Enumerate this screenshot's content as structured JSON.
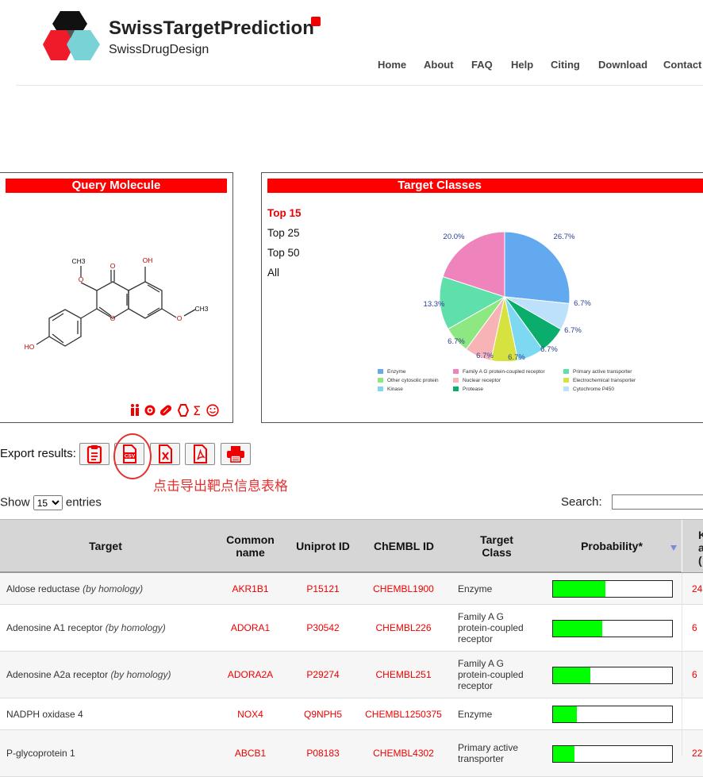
{
  "header": {
    "title": "SwissTargetPrediction",
    "subtitle": "SwissDrugDesign",
    "nav": [
      "Home",
      "About",
      "FAQ",
      "Help",
      "Citing",
      "Download",
      "Contact"
    ]
  },
  "query_panel": {
    "title": "Query Molecule",
    "atom_labels": [
      "CH3",
      "O",
      "O",
      "OH",
      "O",
      "HO",
      "O",
      "CH3"
    ],
    "tool_icons": [
      "family-icon",
      "target-icon",
      "pill-icon",
      "hexagon-icon",
      "sigma-icon",
      "smiley-icon"
    ]
  },
  "target_classes": {
    "title": "Target Classes",
    "options": [
      "Top 15",
      "Top 25",
      "Top 50",
      "All"
    ],
    "selected": "Top 15",
    "labels": [
      "26.7%",
      "6.7%",
      "6.7%",
      "6.7%",
      "6.7%",
      "6.7%",
      "6.7%",
      "13.3%",
      "20.0%"
    ],
    "legend": [
      "Enzyme",
      "Family A G protein-coupled receptor",
      "Primary active transporter",
      "Other cytosolic protein",
      "Nuclear receptor",
      "Electrochemical transporter",
      "Kinase",
      "Protease",
      "Cytochrome P450"
    ]
  },
  "chart_data": {
    "type": "pie",
    "title": "",
    "slices": [
      {
        "label": "Enzyme",
        "value": 26.7,
        "color": "#63a9f0"
      },
      {
        "label": "Cytochrome P450",
        "value": 6.7,
        "color": "#bde0fb"
      },
      {
        "label": "Protease",
        "value": 6.7,
        "color": "#0aad6c"
      },
      {
        "label": "Kinase",
        "value": 6.7,
        "color": "#7dd8f2"
      },
      {
        "label": "Electrochemical transporter",
        "value": 6.7,
        "color": "#d5e240"
      },
      {
        "label": "Nuclear receptor",
        "value": 6.7,
        "color": "#f7b3b6"
      },
      {
        "label": "Other cytosolic protein",
        "value": 6.7,
        "color": "#8ee882"
      },
      {
        "label": "Primary active transporter",
        "value": 13.3,
        "color": "#5fe0ab"
      },
      {
        "label": "Family A G protein-coupled receptor",
        "value": 20.0,
        "color": "#ef84bc"
      }
    ]
  },
  "export": {
    "label": "Export results:",
    "buttons": [
      "clipboard-icon",
      "csv-icon",
      "excel-icon",
      "pdf-icon",
      "print-icon"
    ],
    "annotation": "点击导出靶点信息表格"
  },
  "controls": {
    "show": "Show",
    "length": "15",
    "entries": "entries",
    "search_label": "Search:"
  },
  "table": {
    "columns": [
      "Target",
      "Common name",
      "Uniprot ID",
      "ChEMBL ID",
      "Target Class",
      "Probability*"
    ],
    "rows": [
      {
        "target": "Aldose reductase",
        "homology": "(by homology)",
        "common": "AKR1B1",
        "uniprot": "P15121",
        "chembl": "CHEMBL1900",
        "cls": "Enzyme",
        "prob": 0.44,
        "extra": "24"
      },
      {
        "target": "Adenosine A1 receptor",
        "homology": "(by homology)",
        "common": "ADORA1",
        "uniprot": "P30542",
        "chembl": "CHEMBL226",
        "cls": "Family A G protein-coupled receptor",
        "prob": 0.41,
        "extra": "6"
      },
      {
        "target": "Adenosine A2a receptor",
        "homology": "(by homology)",
        "common": "ADORA2A",
        "uniprot": "P29274",
        "chembl": "CHEMBL251",
        "cls": "Family A G protein-coupled receptor",
        "prob": 0.31,
        "extra": "6"
      },
      {
        "target": "NADPH oxidase 4",
        "homology": "",
        "common": "NOX4",
        "uniprot": "Q9NPH5",
        "chembl": "CHEMBL1250375",
        "cls": "Enzyme",
        "prob": 0.2,
        "extra": ""
      },
      {
        "target": "P-glycoprotein 1",
        "homology": "",
        "common": "ABCB1",
        "uniprot": "P08183",
        "chembl": "CHEMBL4302",
        "cls": "Primary active transporter",
        "prob": 0.18,
        "extra": "22"
      }
    ]
  }
}
